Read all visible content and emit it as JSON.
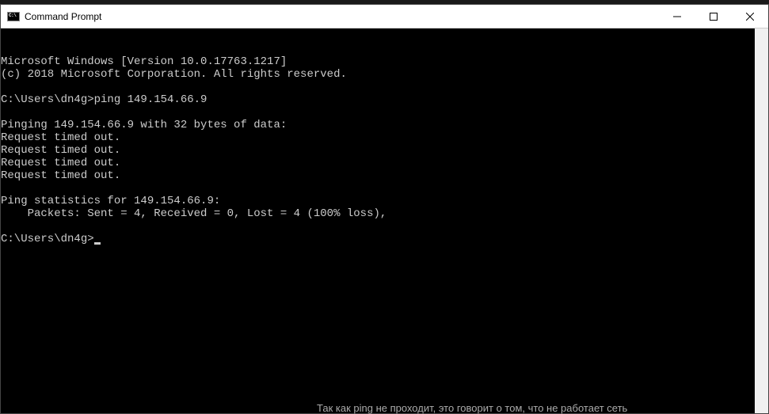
{
  "window": {
    "title": "Command Prompt"
  },
  "terminal": {
    "lines": [
      "Microsoft Windows [Version 10.0.17763.1217]",
      "(c) 2018 Microsoft Corporation. All rights reserved.",
      "",
      "C:\\Users\\dn4g>ping 149.154.66.9",
      "",
      "Pinging 149.154.66.9 with 32 bytes of data:",
      "Request timed out.",
      "Request timed out.",
      "Request timed out.",
      "Request timed out.",
      "",
      "Ping statistics for 149.154.66.9:",
      "    Packets: Sent = 4, Received = 0, Lost = 4 (100% loss),",
      "",
      "C:\\Users\\dn4g>"
    ],
    "prompt": "C:\\Users\\dn4g>",
    "show_cursor_on_last": true
  },
  "background_text": "Так как ping не проходит, это говорит о том, что не работает сеть"
}
